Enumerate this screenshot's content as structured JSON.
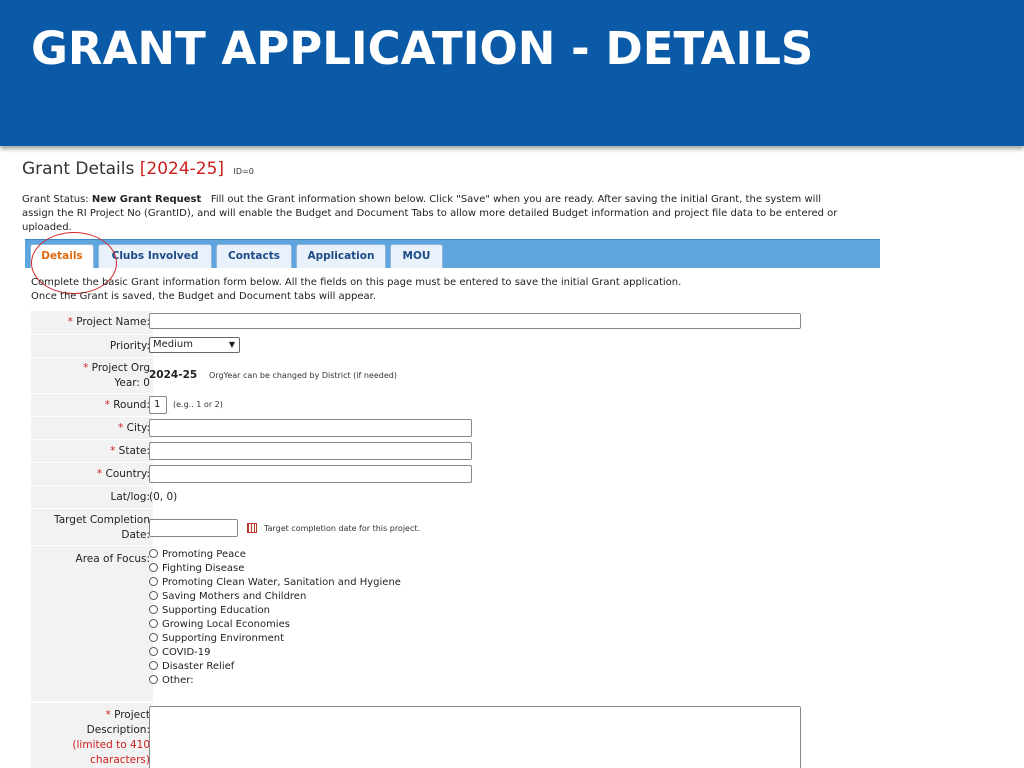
{
  "slide": {
    "title": "GRANT APPLICATION - DETAILS"
  },
  "header": {
    "label": "Grant Details",
    "year": "[2024-25]",
    "id_text": "ID=0"
  },
  "status": {
    "label": "Grant Status:",
    "value": "New Grant Request",
    "line1": "Fill out the Grant information shown below. Click \"Save\" when you are ready. After saving the initial Grant, the system will",
    "line2": "assign the RI Project No (GrantID), and will enable the Budget and Document Tabs to allow more detailed Budget information and project file data to be entered or",
    "line3": "uploaded."
  },
  "tabs": [
    "Details",
    "Clubs Involved",
    "Contacts",
    "Application",
    "MOU"
  ],
  "intro": {
    "line1": "Complete the basic Grant information form below. All the fields on this page must be entered to save the initial Grant application.",
    "line2": "Once the Grant is saved, the Budget and Document tabs will appear."
  },
  "form": {
    "project_name": {
      "label": "Project Name:",
      "value": ""
    },
    "priority": {
      "label": "Priority:",
      "value": "Medium"
    },
    "org_year": {
      "label1": "Project Org",
      "label2": "Year: 0",
      "value": "2024-25",
      "note": "OrgYear can be changed by District (if needed)"
    },
    "round": {
      "label": "Round:",
      "value": "1",
      "hint": "(e.g.. 1 or 2)"
    },
    "city": {
      "label": "City:",
      "value": ""
    },
    "state": {
      "label": "State:",
      "value": ""
    },
    "country": {
      "label": "Country:",
      "value": ""
    },
    "latlog": {
      "label": "Lat/log:",
      "value": "(0, 0)"
    },
    "target": {
      "label1": "Target Completion",
      "label2": "Date:",
      "value": "",
      "hint": "Target completion date for this project."
    },
    "focus": {
      "label": "Area of Focus:",
      "options": [
        "Promoting Peace",
        "Fighting Disease",
        "Promoting Clean Water, Sanitation and Hygiene",
        "Saving Mothers and Children",
        "Supporting Education",
        "Growing Local Economies",
        "Supporting Environment",
        "COVID-19",
        "Disaster Relief",
        "Other:"
      ]
    },
    "description": {
      "label1": "Project",
      "label2": "Description:",
      "limit1": "(limited to 410",
      "limit2": "characters)",
      "value": ""
    }
  },
  "req_mark": "*",
  "colors": {
    "banner": "#0b5aa7",
    "tabbar": "#5fa6de",
    "active_tab": "#e06a10",
    "required": "#cc1f1f",
    "highlight_circle": "#d42a2a"
  },
  "icons": {
    "calendar": "calendar-icon",
    "dropdown": "chevron-down-icon"
  }
}
